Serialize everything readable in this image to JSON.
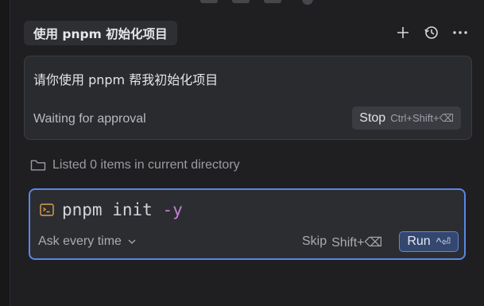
{
  "header": {
    "title": "使用 pnpm 初始化项目",
    "actions": [
      {
        "icon": "plus-icon",
        "label": "+"
      },
      {
        "icon": "history-icon",
        "label": "history"
      },
      {
        "icon": "more-icon",
        "label": "···"
      }
    ]
  },
  "prompt": {
    "text": "请你使用 pnpm 帮我初始化项目",
    "status": "Waiting for approval",
    "stop_label": "Stop",
    "stop_shortcut": "Ctrl+Shift+⌫"
  },
  "tool_result": {
    "icon": "folder-icon",
    "text": "Listed 0 items in current directory"
  },
  "command": {
    "icon": "terminal-icon",
    "cmd": "pnpm init",
    "flag": "-y",
    "approval_mode": "Ask every time",
    "skip_label": "Skip",
    "skip_shortcut": "Shift+⌫",
    "run_label": "Run",
    "run_shortcut": "^⏎"
  },
  "colors": {
    "accent": "#5a86e6",
    "flag": "#c47fd9",
    "background": "#1f1f22"
  }
}
